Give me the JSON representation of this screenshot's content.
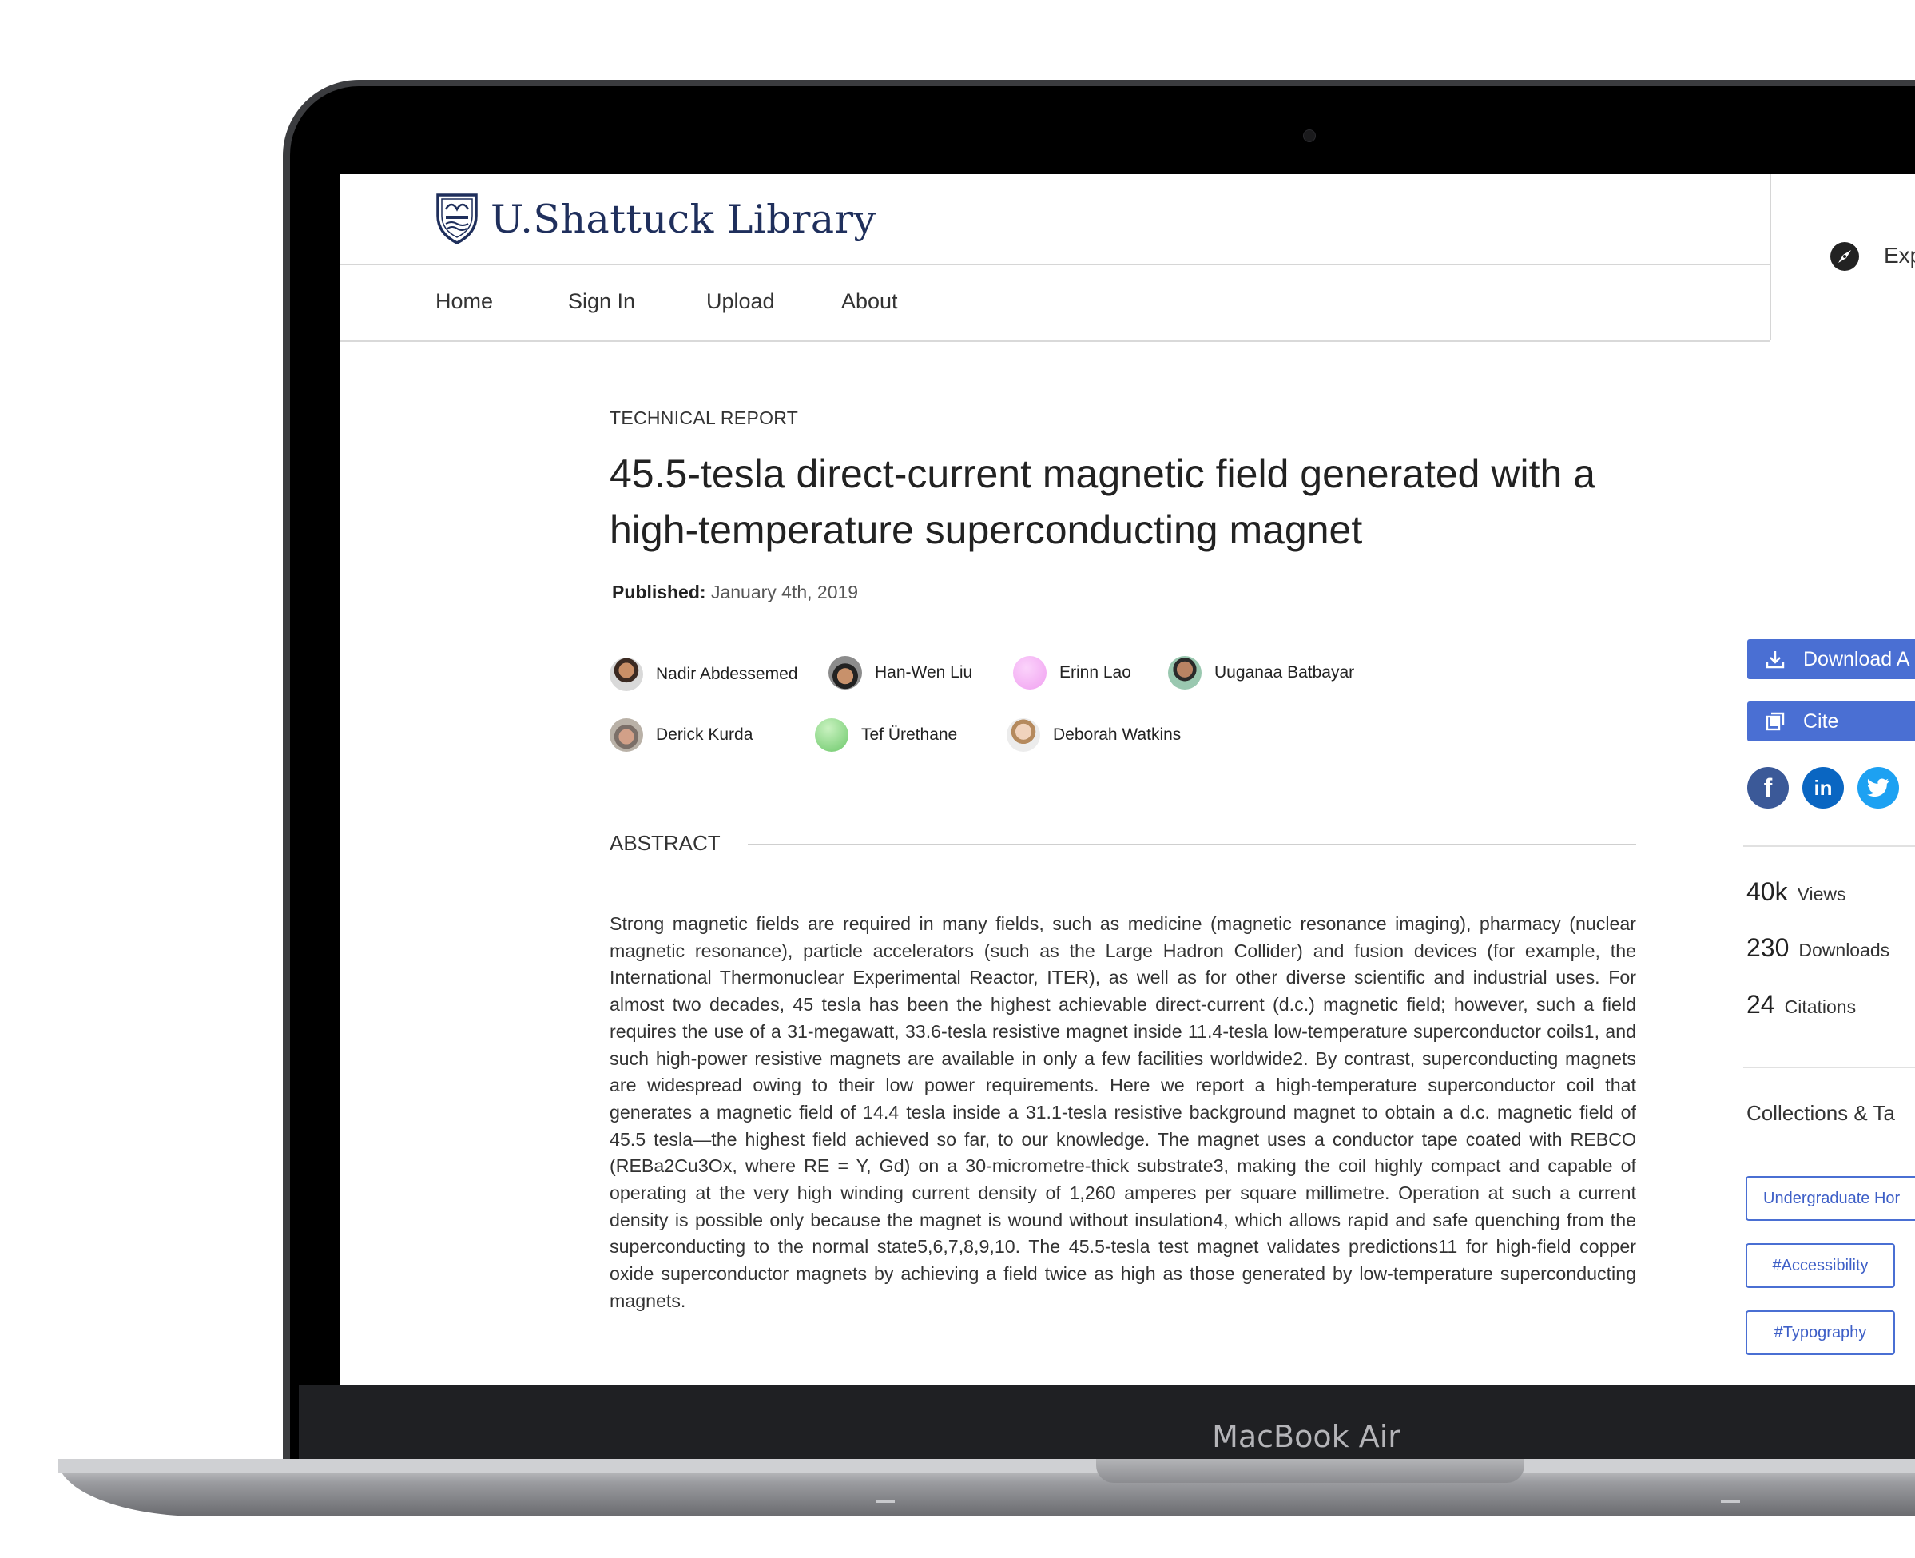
{
  "device": {
    "brand_label": "MacBook Air"
  },
  "header": {
    "logo_text": "U.Shattuck Library",
    "nav": [
      "Home",
      "Sign In",
      "Upload",
      "About"
    ],
    "explore_label": "Exp"
  },
  "article": {
    "type_label": "TECHNICAL REPORT",
    "title": "45.5-tesla direct-current magnetic field generated with a high-temperature superconducting magnet",
    "published_label": "Published:",
    "published_value": "January 4th, 2019",
    "authors": [
      "Nadir Abdessemed",
      "Han-Wen Liu",
      "Erinn Lao",
      "Uuganaa Batbayar",
      "Derick Kurda",
      "Tef Ürethane",
      "Deborah Watkins"
    ],
    "abstract_heading": "ABSTRACT",
    "abstract_text": "Strong magnetic fields are required in many fields, such as medicine (magnetic resonance imaging), pharmacy (nuclear magnetic resonance), particle accelerators (such as the Large Hadron Collider) and fusion devices (for example, the International Thermonuclear Experimental Reactor, ITER), as well as for other diverse scientific and industrial uses. For almost two decades, 45 tesla has been the highest achievable direct-current (d.c.) magnetic field; however, such a field requires the use of a 31-megawatt, 33.6-tesla resistive magnet inside 11.4-tesla low-temperature superconductor coils1, and such high-power resistive magnets are available in only a few facilities worldwide2. By contrast, superconducting magnets are widespread owing to their low power requirements. Here we report a high-temperature superconductor coil that generates a magnetic field of 14.4 tesla inside a 31.1-tesla resistive background magnet to obtain a d.c. magnetic field of 45.5 tesla—the highest field achieved so far, to our knowledge. The magnet uses a conductor tape coated with REBCO (REBa2Cu3Ox, where RE = Y, Gd) on a 30-micrometre-thick substrate3, making the coil highly compact and capable of operating at the very high winding current density of 1,260 amperes per square millimetre. Operation at such a current density is possible only because the magnet is wound without insulation4, which allows rapid and safe quenching from the superconducting to the normal state5,6,7,8,9,10. The 45.5-tesla test magnet validates predictions11 for high-field copper oxide superconductor magnets by achieving a field twice as high as those generated by low-temperature superconducting magnets."
  },
  "sidebar": {
    "download_label": "Download A",
    "cite_label": "Cite",
    "social": [
      "f",
      "in"
    ],
    "stats": [
      {
        "value": "40k",
        "label": "Views"
      },
      {
        "value": "230",
        "label": "Downloads"
      },
      {
        "value": "24",
        "label": "Citations"
      }
    ],
    "collections_heading": "Collections & Ta",
    "tags": [
      "Undergraduate Hor",
      "#Accessibility",
      "#Typography"
    ]
  },
  "colors": {
    "accent": "#4a6fd3",
    "logo": "#1f2f5c",
    "facebook": "#3b5998",
    "linkedin": "#0a66c2",
    "twitter": "#1da1f2"
  }
}
